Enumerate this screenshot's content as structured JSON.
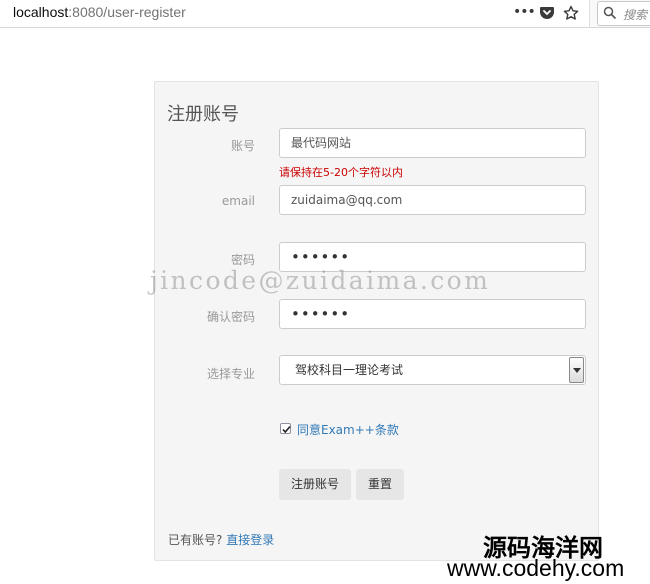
{
  "browser": {
    "url_host": "localhost",
    "url_path": ":8080/user-register",
    "search_placeholder": "搜索"
  },
  "form": {
    "title": "注册账号",
    "account": {
      "label": "账号",
      "value": "最代码网站",
      "error": "请保持在5-20个字符以内"
    },
    "email": {
      "label": "email",
      "value": "zuidaima@qq.com"
    },
    "password": {
      "label": "密码",
      "value": "••••••"
    },
    "confirm": {
      "label": "确认密码",
      "value": "••••••"
    },
    "major": {
      "label": "选择专业",
      "selected": "驾校科目一理论考试"
    },
    "agree": {
      "checked": true,
      "text": "同意Exam++条款"
    },
    "register_button": "注册账号",
    "reset_button": "重置",
    "login_prompt": "已有账号?",
    "login_link": "直接登录"
  },
  "watermarks": {
    "email": "jincode@zuidaima.com",
    "site_name": "源码海洋网",
    "site_url": "www.codehy.com"
  },
  "colors": {
    "link": "#337ab7",
    "error": "#cc0000",
    "panel": "#f5f5f5"
  }
}
